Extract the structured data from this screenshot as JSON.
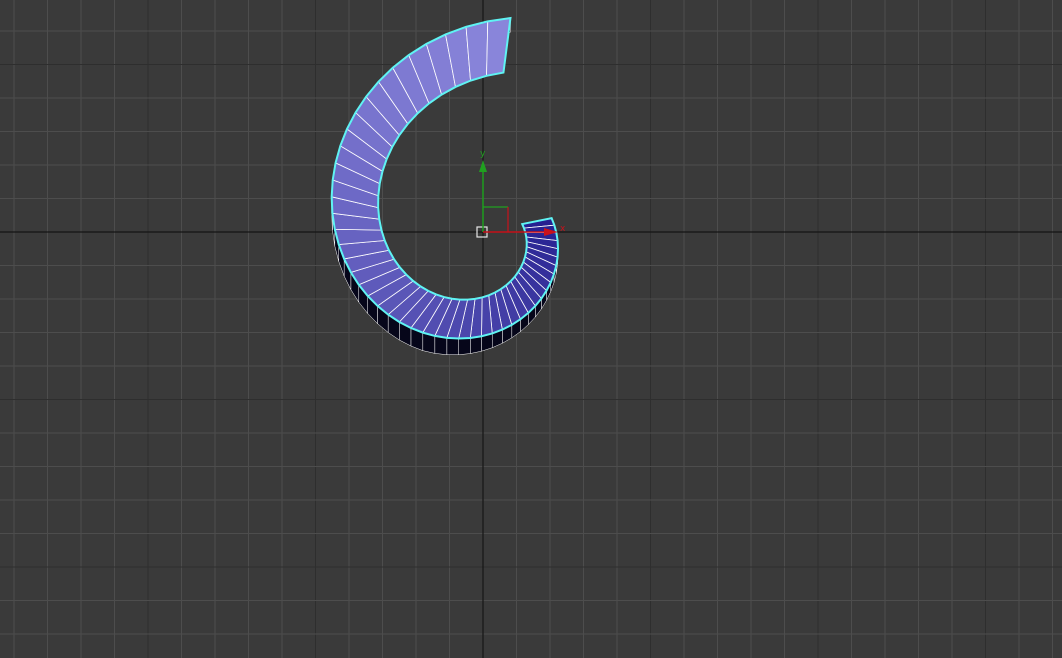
{
  "viewport": {
    "background_color": "#3a3a3a",
    "grid_minor_color": "#4d4d4d",
    "grid_major_color": "#2e2e2e",
    "axis_line_color": "#151515"
  },
  "object": {
    "shape": "spiral-ribbon",
    "selected": true,
    "selection_outline_color": "#5ff3f3",
    "wire_color": "#ffffff",
    "color_start": "#241f8f",
    "color_end": "#8a86db",
    "side_face_color": "#06061a"
  },
  "gizmo": {
    "x_label": "x",
    "y_label": "y",
    "x_axis_color": "#c8121b",
    "y_axis_color": "#20a020",
    "plane_handle_color": "#cfcfcf",
    "pivot_icon": "pivot-square-icon"
  }
}
